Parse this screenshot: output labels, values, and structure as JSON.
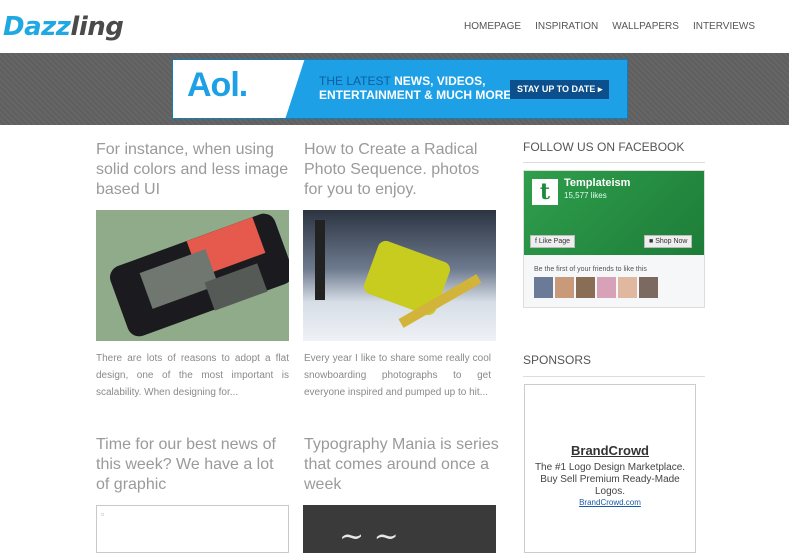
{
  "header": {
    "logo_a": "Dazz",
    "logo_b": "ling",
    "nav": [
      "HOMEPAGE",
      "INSPIRATION",
      "WALLPAPERS",
      "INTERVIEWS"
    ]
  },
  "banner": {
    "brand": "Aol.",
    "lead": "THE LATEST",
    "line1": " NEWS, VIDEOS,",
    "line2": "ENTERTAINMENT & MUCH MORE",
    "cta": "STAY UP TO DATE ▸"
  },
  "posts": [
    {
      "title": "For instance, when using solid colors and less image based UI",
      "excerpt": "There are lots of reasons to adopt a flat design, one of the most important is scalability. When designing for..."
    },
    {
      "title": "How to Create a Radical Photo Sequence. photos for you to enjoy.",
      "excerpt": "Every year I like to share some really cool snowboarding photographs to get everyone inspired and pumped up to hit..."
    },
    {
      "title": "Time for our best news of this week? We have a lot of graphic",
      "excerpt": ""
    },
    {
      "title": "Typography Mania is series that comes around once a week",
      "excerpt": ""
    }
  ],
  "sidebar": {
    "facebook_title": "FOLLOW US ON FACEBOOK",
    "fb_page_name": "Templateism",
    "fb_likes": "15,577 likes",
    "fb_like_button": "Like Page",
    "fb_shop_button": "Shop Now",
    "fb_friends_text": "Be the first of your friends to like this",
    "sponsors_title": "SPONSORS",
    "sponsor_name": "BrandCrowd",
    "sponsor_desc": "The #1 Logo Design Marketplace. Buy Sell Premium Ready-Made Logos.",
    "sponsor_link": "BrandCrowd.com"
  },
  "colors": {
    "brand_blue": "#1fa8e1",
    "aol_blue": "#1ea0e6",
    "fb_green": "#2f9e4c"
  }
}
